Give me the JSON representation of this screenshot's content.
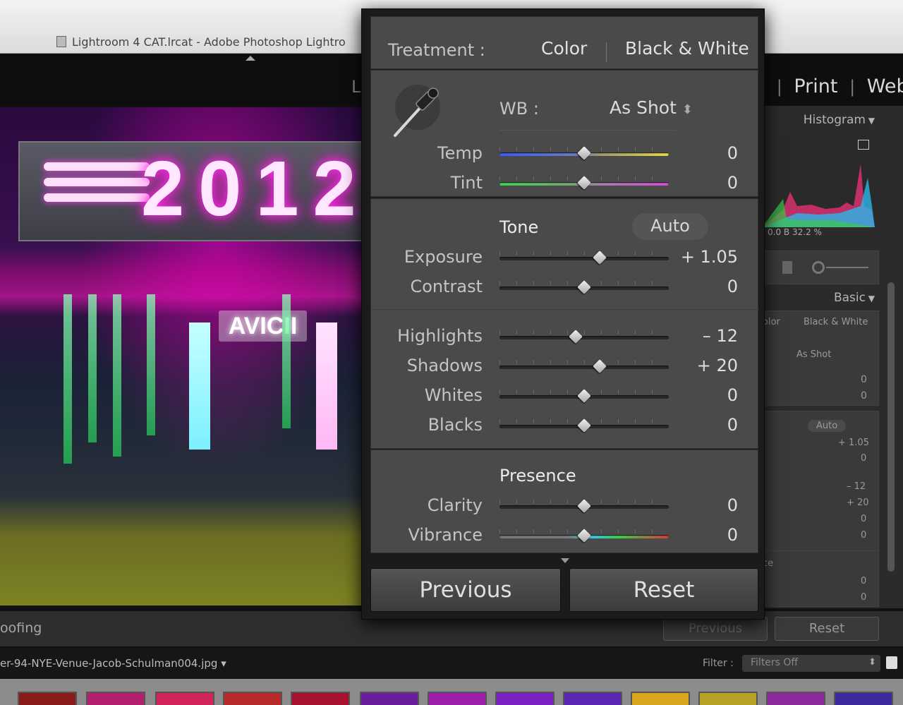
{
  "window": {
    "title": "Lightroom 4 CAT.lrcat - Adobe Photoshop Lightro"
  },
  "modules": {
    "partial_left": "L",
    "items": [
      "Print",
      "Web"
    ]
  },
  "photo": {
    "year_text": "2012",
    "sign_text": "AVICII"
  },
  "hud": {
    "treatment": {
      "label": "Treatment :",
      "options": [
        "Color",
        "Black & White"
      ],
      "selected": "Color"
    },
    "wb": {
      "label": "WB :",
      "value": "As Shot",
      "sliders": [
        {
          "label": "Temp",
          "value": "0",
          "position": 0.5,
          "gradient": "temp"
        },
        {
          "label": "Tint",
          "value": "0",
          "position": 0.5,
          "gradient": "tint"
        }
      ]
    },
    "tone": {
      "title": "Tone",
      "auto_label": "Auto",
      "group1": [
        {
          "label": "Exposure",
          "value": "+ 1.05",
          "position": 0.59
        },
        {
          "label": "Contrast",
          "value": "0",
          "position": 0.5
        }
      ],
      "group2": [
        {
          "label": "Highlights",
          "value": "– 12",
          "position": 0.45
        },
        {
          "label": "Shadows",
          "value": "+ 20",
          "position": 0.59
        },
        {
          "label": "Whites",
          "value": "0",
          "position": 0.5
        },
        {
          "label": "Blacks",
          "value": "0",
          "position": 0.5
        }
      ]
    },
    "presence": {
      "title": "Presence",
      "sliders": [
        {
          "label": "Clarity",
          "value": "0",
          "position": 0.5
        },
        {
          "label": "Vibrance",
          "value": "0",
          "position": 0.5,
          "gradient": "vibrance"
        }
      ]
    },
    "buttons": {
      "previous": "Previous",
      "reset": "Reset"
    }
  },
  "right_panel": {
    "histogram_label": "Histogram",
    "histogram_readout": {
      "a": "0.0",
      "b_label": "B",
      "b_value": "32.2 %"
    },
    "basic_label": "Basic",
    "treatment_partial": "olor",
    "treatment_bw": "Black & White",
    "wb_value": "As Shot",
    "auto_label": "Auto",
    "values": [
      "0",
      "0",
      "+ 1.05",
      "0",
      "– 12",
      "+ 20",
      "0",
      "0",
      "0",
      "0"
    ],
    "presence_partial": "ce",
    "previous_label": "Previous",
    "reset_label": "Reset"
  },
  "status": {
    "proofing_label": "oofing",
    "filename": "er-94-NYE-Venue-Jacob-Schulman004.jpg",
    "filter_label": "Filter :",
    "filter_value": "Filters Off"
  },
  "colors": {
    "panel_bg": "#4a4a4a",
    "hud_bg": "#1b1b1b",
    "temp_gradient": [
      "#3a5cff",
      "#e6d84a"
    ],
    "tint_gradient": [
      "#3fd24a",
      "#d44bd8"
    ],
    "vibrance_gradient": [
      "#777777",
      "#34c6e6",
      "#d93a3a"
    ]
  }
}
